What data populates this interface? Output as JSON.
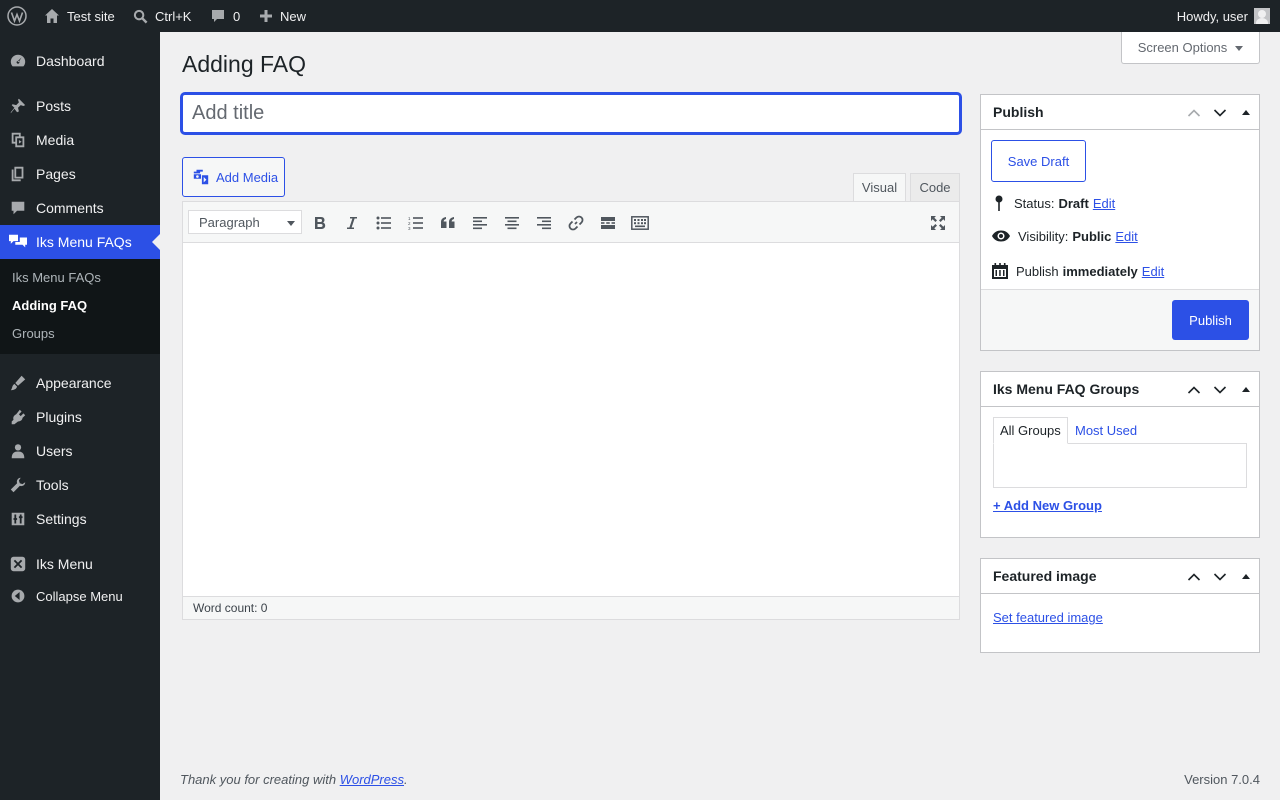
{
  "admin_bar": {
    "site_name": "Test site",
    "search_shortcut": "Ctrl+K",
    "comments_count": "0",
    "new_label": "New",
    "howdy": "Howdy, user"
  },
  "sidebar": {
    "items": [
      {
        "label": "Dashboard",
        "icon": "dashboard-icon"
      },
      {
        "label": "Posts",
        "icon": "pin-icon"
      },
      {
        "label": "Media",
        "icon": "media-icon"
      },
      {
        "label": "Pages",
        "icon": "pages-icon"
      },
      {
        "label": "Comments",
        "icon": "comment-icon"
      },
      {
        "label": "Iks Menu FAQs",
        "icon": "faq-icon",
        "current": true
      },
      {
        "label": "Appearance",
        "icon": "brush-icon"
      },
      {
        "label": "Plugins",
        "icon": "plugin-icon"
      },
      {
        "label": "Users",
        "icon": "user-icon"
      },
      {
        "label": "Tools",
        "icon": "wrench-icon"
      },
      {
        "label": "Settings",
        "icon": "settings-icon"
      },
      {
        "label": "Iks Menu",
        "icon": "iks-menu-icon"
      }
    ],
    "submenu": [
      "Iks Menu FAQs",
      "Adding FAQ",
      "Groups"
    ],
    "submenu_current": "Adding FAQ",
    "collapse_label": "Collapse Menu"
  },
  "screen_options": "Screen Options",
  "page": {
    "title": "Adding FAQ",
    "title_placeholder": "Add title",
    "title_value": ""
  },
  "editor": {
    "add_media": "Add Media",
    "tab_visual": "Visual",
    "tab_code": "Code",
    "format": "Paragraph",
    "toolbar_icons": [
      "bold-icon",
      "italic-icon",
      "bulleted-list-icon",
      "numbered-list-icon",
      "blockquote-icon",
      "align-left-icon",
      "align-center-icon",
      "align-right-icon",
      "link-icon",
      "read-more-icon",
      "toolbar-toggle-icon",
      "fullscreen-icon"
    ],
    "word_count": "Word count: 0"
  },
  "publish_box": {
    "title": "Publish",
    "save_draft": "Save Draft",
    "status_label": "Status:",
    "status_value": "Draft",
    "visibility_label": "Visibility:",
    "visibility_value": "Public",
    "publish_label": "Publish",
    "publish_value": "immediately",
    "edit_link": "Edit",
    "publish_button": "Publish"
  },
  "groups_box": {
    "title": "Iks Menu FAQ Groups",
    "tab_all": "All Groups",
    "tab_most_used": "Most Used",
    "add_new": "+ Add New Group"
  },
  "featured_box": {
    "title": "Featured image",
    "set_link": "Set featured image"
  },
  "footer": {
    "thanks_prefix": "Thank you for creating with ",
    "thanks_link": "WordPress",
    "thanks_suffix": ".",
    "version": "Version 7.0.4"
  },
  "colors": {
    "accent": "#2c50e6",
    "admin_dark": "#1d2327",
    "background": "#f0f0f1"
  }
}
